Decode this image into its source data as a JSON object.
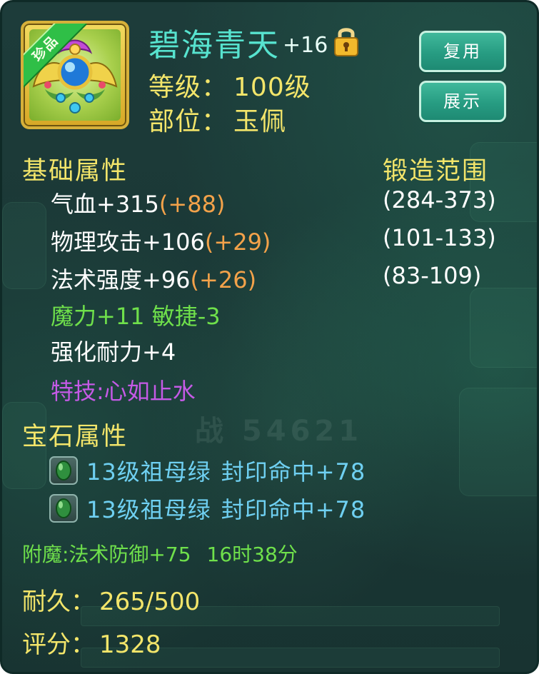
{
  "item": {
    "name": "碧海青天",
    "plus": "+16",
    "rarity_badge": "珍品",
    "locked": true,
    "level_label": "等级：",
    "level_value": "100级",
    "slot_label": "部位：",
    "slot_value": "玉佩"
  },
  "buttons": {
    "reuse_label": "复用",
    "show_label": "展示"
  },
  "base_attributes": {
    "title": "基础属性",
    "forge_range_title": "锻造范围",
    "stats": [
      {
        "name": "气血+315",
        "bonus": "(+88)",
        "range": "(284-373)"
      },
      {
        "name": "物理攻击+106",
        "bonus": "(+29)",
        "range": "(101-133)"
      },
      {
        "name": "法术强度+96",
        "bonus": "(+26)",
        "range": "(83-109)"
      }
    ],
    "extra_green": "魔力+11 敏捷-3",
    "extra_white": "强化耐力+4",
    "special_skill": "特技:心如止水"
  },
  "gem_attributes": {
    "title": "宝石属性",
    "gems": [
      {
        "gem": "13级祖母绿",
        "effect": "封印命中+78"
      },
      {
        "gem": "13级祖母绿",
        "effect": "封印命中+78"
      }
    ]
  },
  "enchant": {
    "text": "附魔:法术防御+75",
    "time": "16时38分"
  },
  "durability": {
    "label": "耐久：",
    "value": "265/500"
  },
  "score": {
    "label": "评分：",
    "value": "1328"
  },
  "icons": {
    "lock": "padlock-icon",
    "gem": "emerald-gem-icon",
    "item": "jade-pendant-icon"
  },
  "colors": {
    "item_name": "#57e3cf",
    "label_yellow": "#f3e56a",
    "bonus_orange": "#f3a24a",
    "green_text": "#6fe04b",
    "gem_text": "#6fd0f2",
    "special_purple": "#c55ae6",
    "button_green": "#279c82"
  }
}
